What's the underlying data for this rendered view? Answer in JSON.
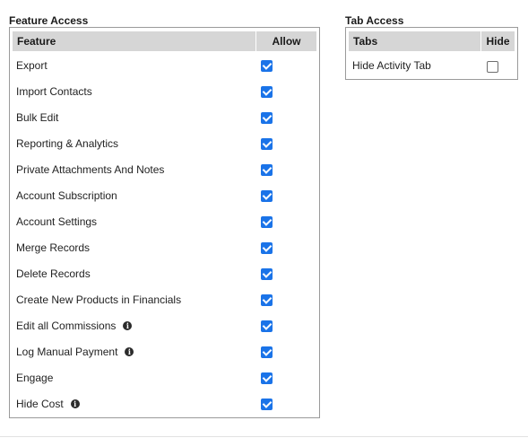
{
  "feature_access": {
    "title": "Feature Access",
    "columns": {
      "feature": "Feature",
      "allow": "Allow"
    },
    "rows": [
      {
        "label": "Export",
        "allowed": true,
        "info": false
      },
      {
        "label": "Import Contacts",
        "allowed": true,
        "info": false
      },
      {
        "label": "Bulk Edit",
        "allowed": true,
        "info": false
      },
      {
        "label": "Reporting & Analytics",
        "allowed": true,
        "info": false
      },
      {
        "label": "Private Attachments And Notes",
        "allowed": true,
        "info": false
      },
      {
        "label": "Account Subscription",
        "allowed": true,
        "info": false
      },
      {
        "label": "Account Settings",
        "allowed": true,
        "info": false
      },
      {
        "label": "Merge Records",
        "allowed": true,
        "info": false
      },
      {
        "label": "Delete Records",
        "allowed": true,
        "info": false
      },
      {
        "label": "Create New Products in Financials",
        "allowed": true,
        "info": false
      },
      {
        "label": "Edit all Commissions",
        "allowed": true,
        "info": true
      },
      {
        "label": "Log Manual Payment",
        "allowed": true,
        "info": true
      },
      {
        "label": "Engage",
        "allowed": true,
        "info": false
      },
      {
        "label": "Hide Cost",
        "allowed": true,
        "info": true
      }
    ]
  },
  "tab_access": {
    "title": "Tab Access",
    "columns": {
      "tabs": "Tabs",
      "hide": "Hide"
    },
    "rows": [
      {
        "label": "Hide Activity Tab",
        "hidden": false
      }
    ]
  },
  "icons": {
    "info": "info-icon",
    "checkbox_checked": "checkbox-checked-icon",
    "checkbox_unchecked": "checkbox-unchecked-icon"
  },
  "colors": {
    "header_bg": "#d6d6d6",
    "panel_border": "#9a9a9a",
    "checkbox_accent": "#1a73e8"
  }
}
